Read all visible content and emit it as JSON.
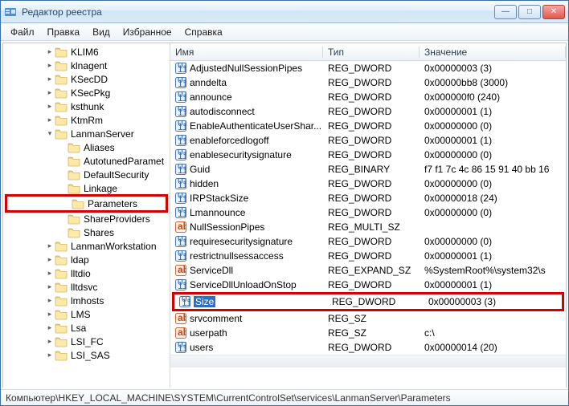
{
  "window": {
    "title": "Редактор реестра"
  },
  "menus": {
    "file": "Файл",
    "edit": "Правка",
    "view": "Вид",
    "favorites": "Избранное",
    "help": "Справка"
  },
  "tree": {
    "items": [
      {
        "depth": 3,
        "exp": "closed",
        "label": "KLIM6"
      },
      {
        "depth": 3,
        "exp": "closed",
        "label": "klnagent"
      },
      {
        "depth": 3,
        "exp": "closed",
        "label": "KSecDD"
      },
      {
        "depth": 3,
        "exp": "closed",
        "label": "KSecPkg"
      },
      {
        "depth": 3,
        "exp": "closed",
        "label": "ksthunk"
      },
      {
        "depth": 3,
        "exp": "closed",
        "label": "KtmRm"
      },
      {
        "depth": 3,
        "exp": "open",
        "label": "LanmanServer"
      },
      {
        "depth": 4,
        "exp": "none",
        "label": "Aliases"
      },
      {
        "depth": 4,
        "exp": "none",
        "label": "AutotunedParamet"
      },
      {
        "depth": 4,
        "exp": "none",
        "label": "DefaultSecurity"
      },
      {
        "depth": 4,
        "exp": "none",
        "label": "Linkage"
      },
      {
        "depth": 4,
        "exp": "none",
        "label": "Parameters",
        "highlighted": true
      },
      {
        "depth": 4,
        "exp": "none",
        "label": "ShareProviders"
      },
      {
        "depth": 4,
        "exp": "none",
        "label": "Shares"
      },
      {
        "depth": 3,
        "exp": "closed",
        "label": "LanmanWorkstation"
      },
      {
        "depth": 3,
        "exp": "closed",
        "label": "ldap"
      },
      {
        "depth": 3,
        "exp": "closed",
        "label": "lltdio"
      },
      {
        "depth": 3,
        "exp": "closed",
        "label": "lltdsvc"
      },
      {
        "depth": 3,
        "exp": "closed",
        "label": "lmhosts"
      },
      {
        "depth": 3,
        "exp": "closed",
        "label": "LMS"
      },
      {
        "depth": 3,
        "exp": "closed",
        "label": "Lsa"
      },
      {
        "depth": 3,
        "exp": "closed",
        "label": "LSI_FC"
      },
      {
        "depth": 3,
        "exp": "closed",
        "label": "LSI_SAS"
      }
    ]
  },
  "columns": {
    "name": "Имя",
    "type": "Тип",
    "value": "Значение"
  },
  "values": [
    {
      "icon": "dword",
      "name": "AdjustedNullSessionPipes",
      "type": "REG_DWORD",
      "value": "0x00000003 (3)"
    },
    {
      "icon": "dword",
      "name": "anndelta",
      "type": "REG_DWORD",
      "value": "0x00000bb8 (3000)"
    },
    {
      "icon": "dword",
      "name": "announce",
      "type": "REG_DWORD",
      "value": "0x000000f0 (240)"
    },
    {
      "icon": "dword",
      "name": "autodisconnect",
      "type": "REG_DWORD",
      "value": "0x00000001 (1)"
    },
    {
      "icon": "dword",
      "name": "EnableAuthenticateUserShar...",
      "type": "REG_DWORD",
      "value": "0x00000000 (0)"
    },
    {
      "icon": "dword",
      "name": "enableforcedlogoff",
      "type": "REG_DWORD",
      "value": "0x00000001 (1)"
    },
    {
      "icon": "dword",
      "name": "enablesecuritysignature",
      "type": "REG_DWORD",
      "value": "0x00000000 (0)"
    },
    {
      "icon": "dword",
      "name": "Guid",
      "type": "REG_BINARY",
      "value": "f7 f1 7c 4c 86 15 91 40 bb 16"
    },
    {
      "icon": "dword",
      "name": "hidden",
      "type": "REG_DWORD",
      "value": "0x00000000 (0)"
    },
    {
      "icon": "dword",
      "name": "IRPStackSize",
      "type": "REG_DWORD",
      "value": "0x00000018 (24)"
    },
    {
      "icon": "dword",
      "name": "Lmannounce",
      "type": "REG_DWORD",
      "value": "0x00000000 (0)"
    },
    {
      "icon": "string",
      "name": "NullSessionPipes",
      "type": "REG_MULTI_SZ",
      "value": ""
    },
    {
      "icon": "dword",
      "name": "requiresecuritysignature",
      "type": "REG_DWORD",
      "value": "0x00000000 (0)"
    },
    {
      "icon": "dword",
      "name": "restrictnullsessaccess",
      "type": "REG_DWORD",
      "value": "0x00000001 (1)"
    },
    {
      "icon": "string",
      "name": "ServiceDll",
      "type": "REG_EXPAND_SZ",
      "value": "%SystemRoot%\\system32\\s"
    },
    {
      "icon": "dword",
      "name": "ServiceDllUnloadOnStop",
      "type": "REG_DWORD",
      "value": "0x00000001 (1)"
    },
    {
      "icon": "dword",
      "name": "Size",
      "type": "REG_DWORD",
      "value": "0x00000003 (3)",
      "selected": true,
      "highlighted": true
    },
    {
      "icon": "string",
      "name": "srvcomment",
      "type": "REG_SZ",
      "value": ""
    },
    {
      "icon": "string",
      "name": "userpath",
      "type": "REG_SZ",
      "value": "c:\\"
    },
    {
      "icon": "dword",
      "name": "users",
      "type": "REG_DWORD",
      "value": "0x00000014 (20)"
    }
  ],
  "status": {
    "path": "Компьютер\\HKEY_LOCAL_MACHINE\\SYSTEM\\CurrentControlSet\\services\\LanmanServer\\Parameters"
  }
}
